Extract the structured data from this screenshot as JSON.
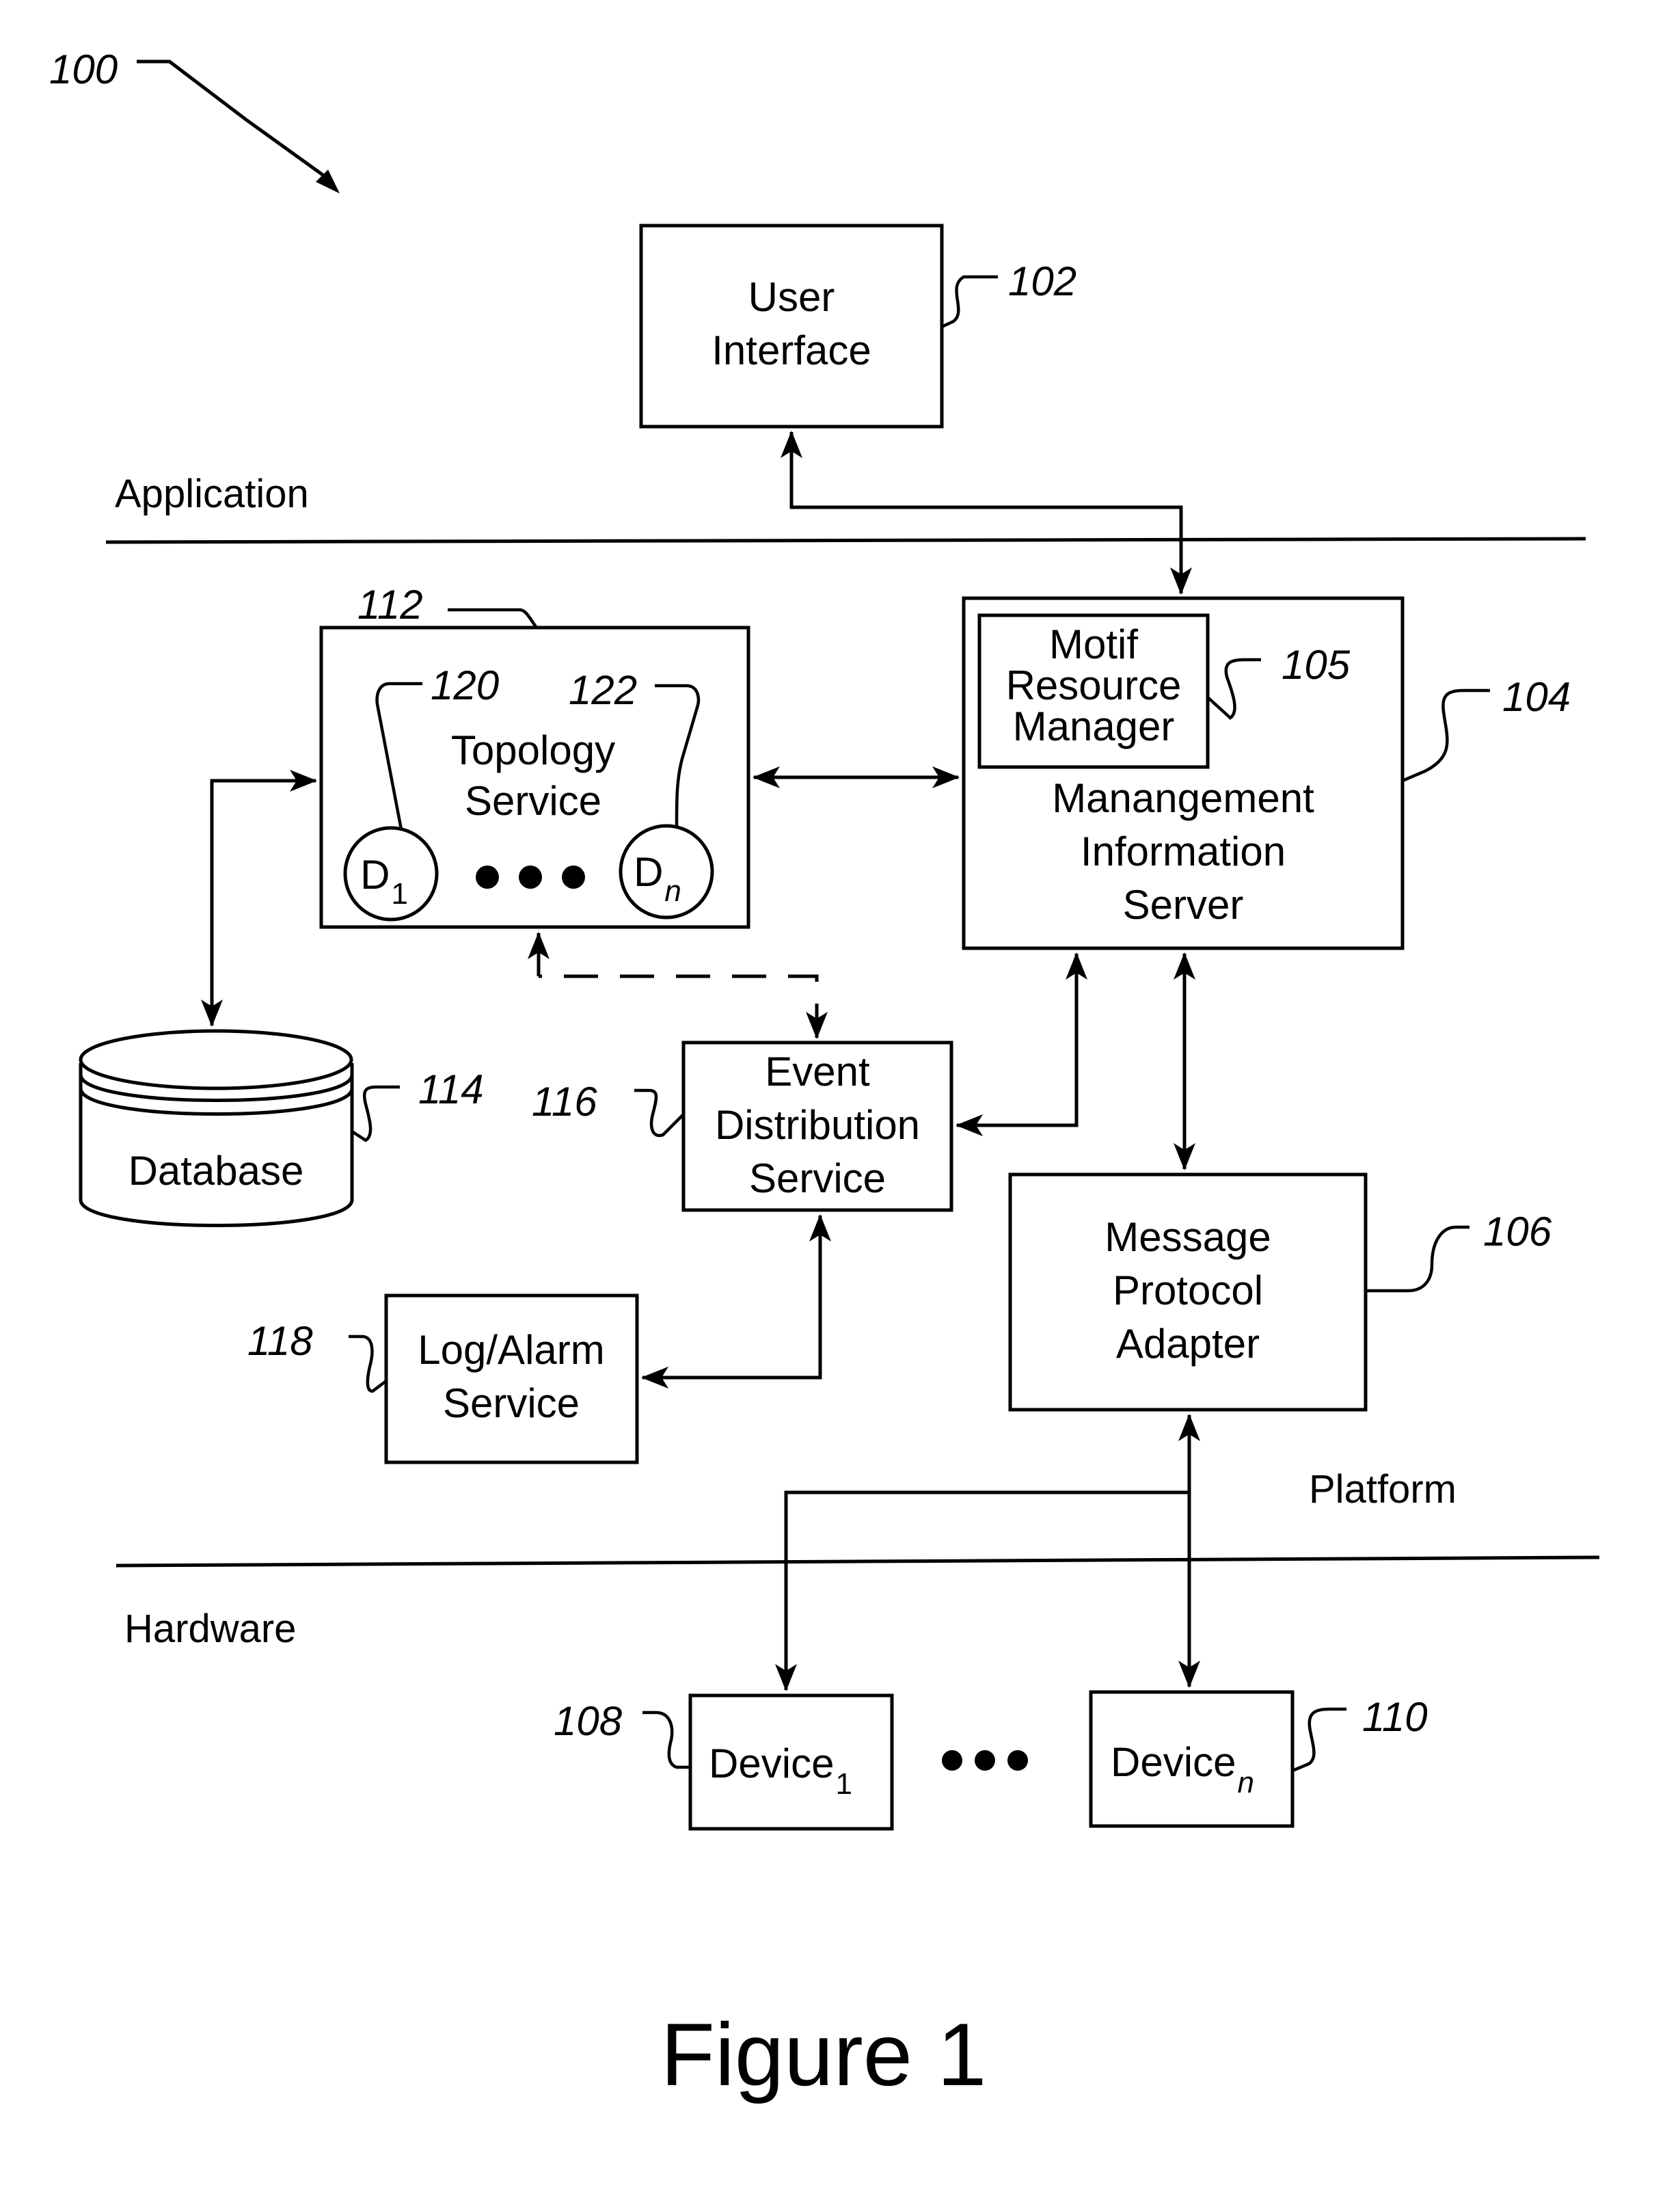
{
  "figure": {
    "title": "Figure 1",
    "reference": "100"
  },
  "layers": {
    "application": "Application",
    "platform": "Platform",
    "hardware": "Hardware"
  },
  "components": {
    "user_interface": {
      "ref": "102",
      "lines": [
        "User",
        "Interface"
      ]
    },
    "management_server": {
      "ref": "104",
      "lines": [
        "Manangement",
        "Information",
        "Server"
      ]
    },
    "motif_manager": {
      "ref": "105",
      "lines": [
        "Motif",
        "Resource",
        "Manager"
      ]
    },
    "message_adapter": {
      "ref": "106",
      "lines": [
        "Message",
        "Protocol",
        "Adapter"
      ]
    },
    "device_1": {
      "ref": "108",
      "label": "Device",
      "subscript": "1"
    },
    "device_n": {
      "ref": "110",
      "label": "Device",
      "subscript": "n"
    },
    "topology_service": {
      "ref": "112",
      "lines": [
        "Topology",
        "Service"
      ]
    },
    "database": {
      "ref": "114",
      "label": "Database"
    },
    "event_distribution": {
      "ref": "116",
      "lines": [
        "Event",
        "Distribution",
        "Service"
      ]
    },
    "log_alarm": {
      "ref": "118",
      "lines": [
        "Log/Alarm",
        "Service"
      ]
    },
    "d1": {
      "ref": "120",
      "label": "D",
      "subscript": "1"
    },
    "dn": {
      "ref": "122",
      "label": "D",
      "subscript": "n"
    }
  }
}
